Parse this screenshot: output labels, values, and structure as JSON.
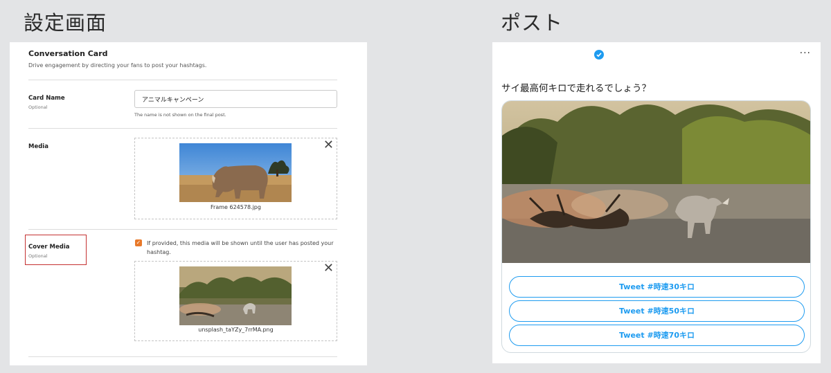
{
  "headings": {
    "settings": "設定画面",
    "post": "ポスト"
  },
  "settings": {
    "card_title": "Conversation Card",
    "card_description": "Drive engagement by directing your fans to post your hashtags.",
    "card_name": {
      "label": "Card Name",
      "sub": "Optional",
      "value": "アニマルキャンペーン",
      "help": "The name is not shown on the final post."
    },
    "media": {
      "label": "Media",
      "filename": "Frame 624578.jpg"
    },
    "cover_media": {
      "label": "Cover Media",
      "sub": "Optional",
      "checkbox_text": "If provided, this media will be shown until the user has posted your hashtag.",
      "checked": true,
      "filename": "unsplash_taYZy_7rrMA.png"
    }
  },
  "post": {
    "question": "サイ最高何キロで走れるでしょう？",
    "more": "···",
    "buttons": [
      "Tweet #時速30キロ",
      "Tweet #時速50キロ",
      "Tweet #時速70キロ"
    ]
  },
  "colors": {
    "accent": "#1d9bf0",
    "checkbox": "#e8792a",
    "highlight": "#c43030"
  }
}
